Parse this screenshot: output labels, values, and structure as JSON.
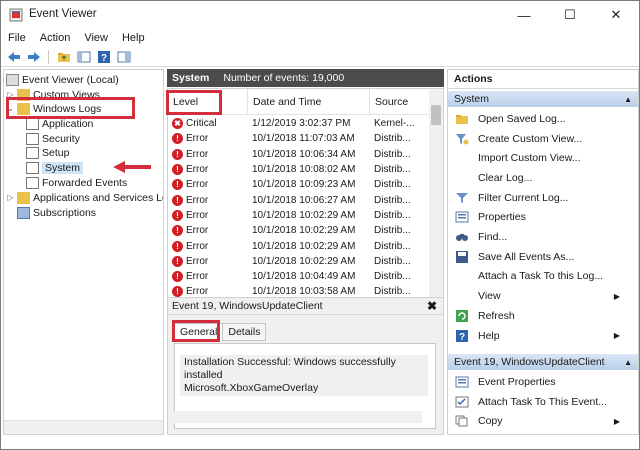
{
  "window": {
    "title": "Event Viewer",
    "minimize": "—",
    "maximize": "☐",
    "close": "✕"
  },
  "menu": [
    "File",
    "Action",
    "View",
    "Help"
  ],
  "toolbar": {
    "icons": [
      "back-arrow-icon",
      "forward-arrow-icon",
      "up-folder-icon",
      "console-tree-icon",
      "help-icon",
      "properties-icon"
    ]
  },
  "tree": {
    "root": "Event Viewer (Local)",
    "custom_views": "Custom Views",
    "windows_logs": "Windows Logs",
    "application": "Application",
    "security": "Security",
    "setup": "Setup",
    "system": "System",
    "forwarded_events": "Forwarded Events",
    "apps_services": "Applications and Services Log",
    "subscriptions": "Subscriptions"
  },
  "center": {
    "log_name": "System",
    "count_label": "Number of events: 19,000",
    "columns": {
      "level": "Level",
      "datetime": "Date and Time",
      "source": "Source"
    },
    "rows": [
      {
        "level": "Critical",
        "datetime": "1/12/2019 3:02:37 PM",
        "source": "Kernel-..."
      },
      {
        "level": "Error",
        "datetime": "10/1/2018 11:07:03 AM",
        "source": "Distrib..."
      },
      {
        "level": "Error",
        "datetime": "10/1/2018 10:06:34 AM",
        "source": "Distrib..."
      },
      {
        "level": "Error",
        "datetime": "10/1/2018 10:08:02 AM",
        "source": "Distrib..."
      },
      {
        "level": "Error",
        "datetime": "10/1/2018 10:09:23 AM",
        "source": "Distrib..."
      },
      {
        "level": "Error",
        "datetime": "10/1/2018 10:06:27 AM",
        "source": "Distrib..."
      },
      {
        "level": "Error",
        "datetime": "10/1/2018 10:02:29 AM",
        "source": "Distrib..."
      },
      {
        "level": "Error",
        "datetime": "10/1/2018 10:02:29 AM",
        "source": "Distrib..."
      },
      {
        "level": "Error",
        "datetime": "10/1/2018 10:02:29 AM",
        "source": "Distrib..."
      },
      {
        "level": "Error",
        "datetime": "10/1/2018 10:02:29 AM",
        "source": "Distrib..."
      },
      {
        "level": "Error",
        "datetime": "10/1/2018 10:04:49 AM",
        "source": "Distrib..."
      },
      {
        "level": "Error",
        "datetime": "10/1/2018 10:03:58 AM",
        "source": "Distrib..."
      }
    ],
    "detail": {
      "title": "Event 19, WindowsUpdateClient",
      "close": "✖",
      "tab_general": "General",
      "tab_details": "Details",
      "text_line1": "Installation Successful: Windows successfully installed",
      "text_line2": "Microsoft.XboxGameOverlay"
    }
  },
  "actions": {
    "header": "Actions",
    "group1": "System",
    "items1": [
      {
        "label": "Open Saved Log...",
        "icon": "folder-open-icon"
      },
      {
        "label": "Create Custom View...",
        "icon": "filter-create-icon"
      },
      {
        "label": "Import Custom View...",
        "icon": ""
      },
      {
        "label": "Clear Log...",
        "icon": ""
      },
      {
        "label": "Filter Current Log...",
        "icon": "filter-icon"
      },
      {
        "label": "Properties",
        "icon": "properties-icon"
      },
      {
        "label": "Find...",
        "icon": "binoculars-icon"
      },
      {
        "label": "Save All Events As...",
        "icon": "save-icon"
      },
      {
        "label": "Attach a Task To this Log...",
        "icon": ""
      },
      {
        "label": "View",
        "icon": "",
        "submenu": true
      },
      {
        "label": "Refresh",
        "icon": "refresh-icon"
      },
      {
        "label": "Help",
        "icon": "help-icon",
        "submenu": true
      }
    ],
    "group2": "Event 19, WindowsUpdateClient",
    "items2": [
      {
        "label": "Event Properties",
        "icon": "properties-icon"
      },
      {
        "label": "Attach Task To This Event...",
        "icon": "task-icon"
      },
      {
        "label": "Copy",
        "icon": "copy-icon",
        "submenu": true
      }
    ]
  },
  "colors": {
    "annotation": "#d42e3c",
    "header_dark": "#4c4c4c",
    "error": "#d11f26",
    "selection": "#cce4f7"
  }
}
